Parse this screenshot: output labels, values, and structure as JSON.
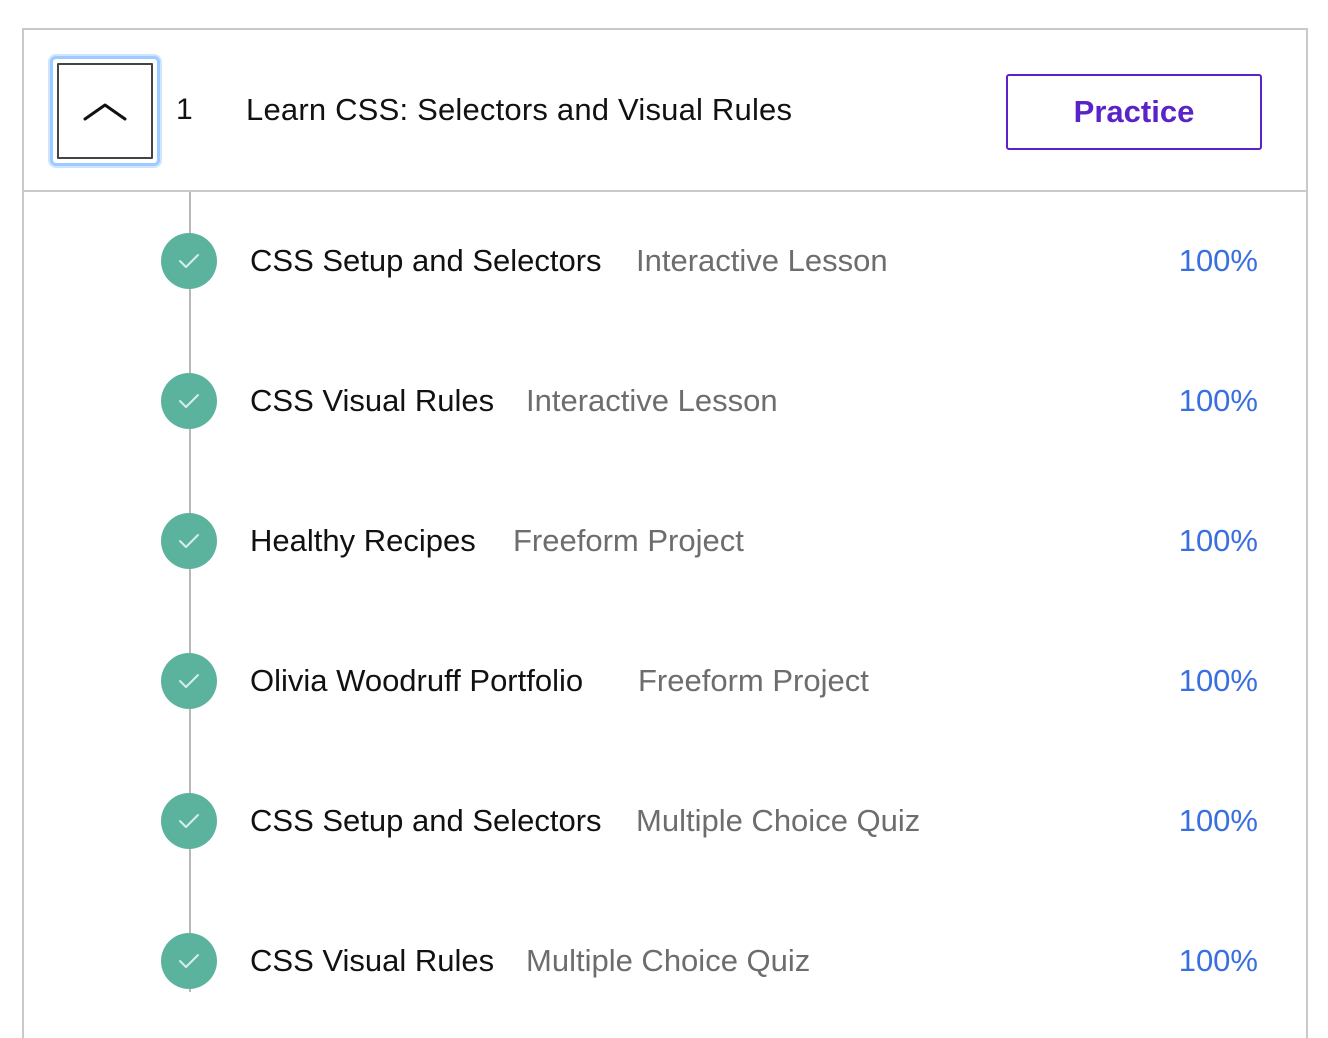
{
  "module": {
    "number": "1",
    "title": "Learn CSS: Selectors and Visual Rules",
    "practice_label": "Practice",
    "toggle_icon": "chevron-up-icon"
  },
  "lessons": [
    {
      "name": "CSS Setup and Selectors",
      "type": "Interactive Lesson",
      "progress": "100%",
      "completed": true
    },
    {
      "name": "CSS Visual Rules",
      "type": "Interactive Lesson",
      "progress": "100%",
      "completed": true
    },
    {
      "name": "Healthy Recipes",
      "type": "Freeform Project",
      "progress": "100%",
      "completed": true
    },
    {
      "name": "Olivia Woodruff Portfolio",
      "type": "Freeform Project",
      "progress": "100%",
      "completed": true
    },
    {
      "name": "CSS Setup and Selectors",
      "type": "Multiple Choice Quiz",
      "progress": "100%",
      "completed": true
    },
    {
      "name": "CSS Visual Rules",
      "type": "Multiple Choice Quiz",
      "progress": "100%",
      "completed": true
    }
  ],
  "colors": {
    "accent_purple": "#5a23c8",
    "check_green": "#5bb39e",
    "progress_blue": "#3a6fe0",
    "muted_gray": "#6d6d6d",
    "focus_ring": "#9ecbff"
  }
}
